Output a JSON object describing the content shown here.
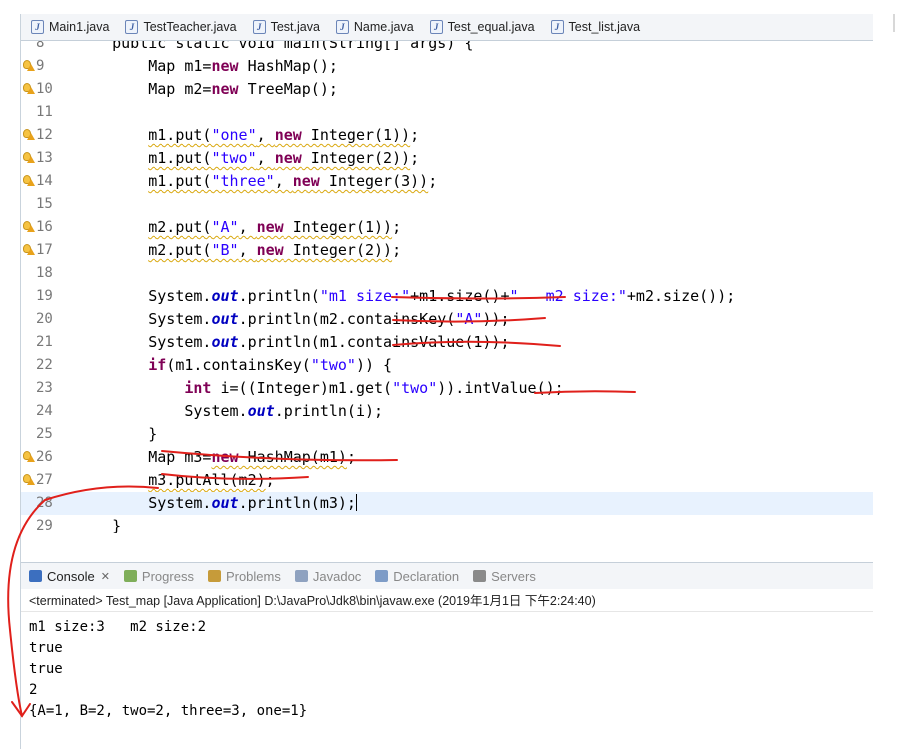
{
  "tabs": [
    {
      "label": "Main1.java"
    },
    {
      "label": "TestTeacher.java"
    },
    {
      "label": "Test.java"
    },
    {
      "label": "Name.java"
    },
    {
      "label": "Test_equal.java"
    },
    {
      "label": "Test_list.java"
    }
  ],
  "editor": {
    "lines": [
      {
        "num": "8",
        "marker": "",
        "segments": [
          {
            "t": "    public static void main(String[] args) {"
          }
        ]
      },
      {
        "num": "9",
        "marker": "warning",
        "segments": [
          {
            "t": "        Map m1="
          },
          {
            "t": "new",
            "c": "kw"
          },
          {
            "t": " HashMap();"
          }
        ]
      },
      {
        "num": "10",
        "marker": "warning",
        "segments": [
          {
            "t": "        Map m2="
          },
          {
            "t": "new",
            "c": "kw"
          },
          {
            "t": " TreeMap();"
          }
        ]
      },
      {
        "num": "11",
        "marker": "",
        "segments": []
      },
      {
        "num": "12",
        "marker": "warning",
        "segments": [
          {
            "t": "        "
          },
          {
            "t": "m1.put(",
            "c": "squig"
          },
          {
            "t": "\"one\"",
            "c": "str squig"
          },
          {
            "t": ", ",
            "c": "squig"
          },
          {
            "t": "new",
            "c": "kw squig"
          },
          {
            "t": " Integer(1))",
            "c": "squig"
          },
          {
            "t": ";"
          }
        ]
      },
      {
        "num": "13",
        "marker": "warning",
        "segments": [
          {
            "t": "        "
          },
          {
            "t": "m1.put(",
            "c": "squig"
          },
          {
            "t": "\"two\"",
            "c": "str squig"
          },
          {
            "t": ", ",
            "c": "squig"
          },
          {
            "t": "new",
            "c": "kw squig"
          },
          {
            "t": " Integer(2))",
            "c": "squig"
          },
          {
            "t": ";"
          }
        ]
      },
      {
        "num": "14",
        "marker": "warning",
        "segments": [
          {
            "t": "        "
          },
          {
            "t": "m1.put(",
            "c": "squig"
          },
          {
            "t": "\"three\"",
            "c": "str squig"
          },
          {
            "t": ", ",
            "c": "squig"
          },
          {
            "t": "new",
            "c": "kw squig"
          },
          {
            "t": " Integer(3))",
            "c": "squig"
          },
          {
            "t": ";"
          }
        ]
      },
      {
        "num": "15",
        "marker": "",
        "segments": []
      },
      {
        "num": "16",
        "marker": "warning",
        "segments": [
          {
            "t": "        "
          },
          {
            "t": "m2.put(",
            "c": "squig"
          },
          {
            "t": "\"A\"",
            "c": "str squig"
          },
          {
            "t": ", ",
            "c": "squig"
          },
          {
            "t": "new",
            "c": "kw squig"
          },
          {
            "t": " Integer(1))",
            "c": "squig"
          },
          {
            "t": ";"
          }
        ]
      },
      {
        "num": "17",
        "marker": "warning",
        "segments": [
          {
            "t": "        "
          },
          {
            "t": "m2.put(",
            "c": "squig"
          },
          {
            "t": "\"B\"",
            "c": "str squig"
          },
          {
            "t": ", ",
            "c": "squig"
          },
          {
            "t": "new",
            "c": "kw squig"
          },
          {
            "t": " Integer(2))",
            "c": "squig"
          },
          {
            "t": ";"
          }
        ]
      },
      {
        "num": "18",
        "marker": "",
        "segments": []
      },
      {
        "num": "19",
        "marker": "",
        "segments": [
          {
            "t": "        System."
          },
          {
            "t": "out",
            "c": "fld"
          },
          {
            "t": ".println("
          },
          {
            "t": "\"m1 size:\"",
            "c": "str"
          },
          {
            "t": "+m1.size()+"
          },
          {
            "t": "\"   m2 size:\"",
            "c": "str"
          },
          {
            "t": "+m2.size());"
          }
        ]
      },
      {
        "num": "20",
        "marker": "",
        "segments": [
          {
            "t": "        System."
          },
          {
            "t": "out",
            "c": "fld"
          },
          {
            "t": ".println(m2.containsKey("
          },
          {
            "t": "\"A\"",
            "c": "str"
          },
          {
            "t": "));"
          }
        ]
      },
      {
        "num": "21",
        "marker": "",
        "segments": [
          {
            "t": "        System."
          },
          {
            "t": "out",
            "c": "fld"
          },
          {
            "t": ".println(m1.containsValue(1));"
          }
        ]
      },
      {
        "num": "22",
        "marker": "",
        "segments": [
          {
            "t": "        "
          },
          {
            "t": "if",
            "c": "kw"
          },
          {
            "t": "(m1.containsKey("
          },
          {
            "t": "\"two\"",
            "c": "str"
          },
          {
            "t": ")) {"
          }
        ]
      },
      {
        "num": "23",
        "marker": "",
        "segments": [
          {
            "t": "            "
          },
          {
            "t": "int",
            "c": "kw"
          },
          {
            "t": " i=((Integer)m1.get("
          },
          {
            "t": "\"two\"",
            "c": "str"
          },
          {
            "t": ")).intValue();"
          }
        ]
      },
      {
        "num": "24",
        "marker": "",
        "segments": [
          {
            "t": "            System."
          },
          {
            "t": "out",
            "c": "fld"
          },
          {
            "t": ".println(i);"
          }
        ]
      },
      {
        "num": "25",
        "marker": "",
        "segments": [
          {
            "t": "        }"
          }
        ]
      },
      {
        "num": "26",
        "marker": "warning",
        "segments": [
          {
            "t": "        Map m3="
          },
          {
            "t": "new",
            "c": "kw squig"
          },
          {
            "t": " HashMap(m1)",
            "c": "squig"
          },
          {
            "t": ";"
          }
        ]
      },
      {
        "num": "27",
        "marker": "warning",
        "segments": [
          {
            "t": "        "
          },
          {
            "t": "m3.putAll(m2)",
            "c": "squig"
          },
          {
            "t": ";"
          }
        ]
      },
      {
        "num": "28",
        "marker": "",
        "current": true,
        "segments": [
          {
            "t": "        System."
          },
          {
            "t": "out",
            "c": "fld"
          },
          {
            "t": ".println(m3);"
          }
        ]
      },
      {
        "num": "29",
        "marker": "",
        "segments": [
          {
            "t": "    }"
          }
        ]
      }
    ]
  },
  "views": [
    {
      "label": "Console",
      "active": true,
      "icon_color": "#3c6fbf"
    },
    {
      "label": "Progress",
      "active": false,
      "icon_color": "#7fae5a"
    },
    {
      "label": "Problems",
      "active": false,
      "icon_color": "#c69b3a"
    },
    {
      "label": "Javadoc",
      "active": false,
      "icon_color": "#8fa2c0"
    },
    {
      "label": "Declaration",
      "active": false,
      "icon_color": "#7e9cc7"
    },
    {
      "label": "Servers",
      "active": false,
      "icon_color": "#8a8a8a"
    }
  ],
  "console": {
    "status": "<terminated> Test_map [Java Application] D:\\JavaPro\\Jdk8\\bin\\javaw.exe (2019年1月1日 下午2:24:40)",
    "output": [
      "m1 size:3   m2 size:2",
      "true",
      "true",
      "2",
      "{A=1, B=2, two=2, three=3, one=1}"
    ]
  },
  "colors": {
    "annotation": "#e0201b",
    "keyword": "#7f0055",
    "string": "#2a00ff",
    "field": "#0000c0"
  }
}
